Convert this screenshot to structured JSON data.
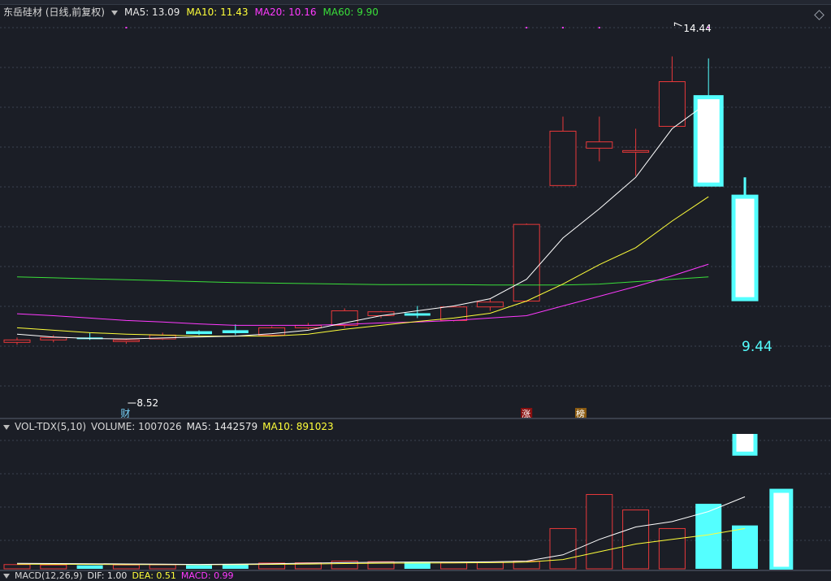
{
  "header": {
    "stock_title": "东岳硅材 (日线,前复权)",
    "ma5_label": "MA5: 13.09",
    "ma10_label": "MA10: 11.43",
    "ma20_label": "MA20: 10.16",
    "ma60_label": "MA60: 9.90"
  },
  "volume_header": {
    "label": "VOL-TDX(5,10)",
    "volume": "VOLUME: 1007026",
    "ma5": "MA5: 1442579",
    "ma10": "MA10: 891023"
  },
  "macd_header": {
    "label": "MACD(12,26,9)",
    "dif": "DIF: 1.00",
    "dea": "DEA: 0.51",
    "macd": "MACD: 0.99"
  },
  "colors": {
    "up": "#e8383a",
    "down": "#54ffff",
    "ma5": "#ffffff",
    "ma10": "#ffff3a",
    "ma20": "#ff3aff",
    "ma60": "#3adf3a",
    "grid": "#3b4150",
    "text": "#d8d8d8"
  },
  "chart_data": {
    "type": "candlestick",
    "price_ylim": [
      7.3,
      15.1
    ],
    "high_label": "14.44",
    "low_label": "8.52",
    "last_close_label": "9.44",
    "markers": {
      "cai": "财",
      "zhang": "涨",
      "bang": "榜"
    },
    "candles": [
      {
        "o": 8.55,
        "h": 8.65,
        "l": 8.5,
        "c": 8.6
      },
      {
        "o": 8.6,
        "h": 8.7,
        "l": 8.55,
        "c": 8.65
      },
      {
        "o": 8.65,
        "h": 8.75,
        "l": 8.6,
        "c": 8.63
      },
      {
        "o": 8.58,
        "h": 8.62,
        "l": 8.52,
        "c": 8.6
      },
      {
        "o": 8.62,
        "h": 8.75,
        "l": 8.6,
        "c": 8.7
      },
      {
        "o": 8.78,
        "h": 8.8,
        "l": 8.7,
        "c": 8.72
      },
      {
        "o": 8.8,
        "h": 8.92,
        "l": 8.7,
        "c": 8.74
      },
      {
        "o": 8.7,
        "h": 8.88,
        "l": 8.68,
        "c": 8.85
      },
      {
        "o": 8.85,
        "h": 8.95,
        "l": 8.82,
        "c": 8.9
      },
      {
        "o": 8.9,
        "h": 9.25,
        "l": 8.85,
        "c": 9.2
      },
      {
        "o": 9.1,
        "h": 9.2,
        "l": 9.05,
        "c": 9.18
      },
      {
        "o": 9.15,
        "h": 9.3,
        "l": 9.05,
        "c": 9.1
      },
      {
        "o": 9.0,
        "h": 9.3,
        "l": 8.98,
        "c": 9.28
      },
      {
        "o": 9.28,
        "h": 9.45,
        "l": 9.2,
        "c": 9.38
      },
      {
        "o": 9.4,
        "h": 11.0,
        "l": 9.38,
        "c": 10.98
      },
      {
        "o": 11.78,
        "h": 13.2,
        "l": 11.78,
        "c": 12.9
      },
      {
        "o": 12.55,
        "h": 13.2,
        "l": 12.28,
        "c": 12.68
      },
      {
        "o": 12.5,
        "h": 12.95,
        "l": 11.98,
        "c": 12.5
      },
      {
        "o": 13.0,
        "h": 14.44,
        "l": 13.0,
        "c": 13.92
      },
      {
        "o": 13.6,
        "h": 14.4,
        "l": 11.8,
        "c": 11.8
      },
      {
        "o": 11.55,
        "h": 11.95,
        "l": 9.44,
        "c": 9.44
      }
    ],
    "ma5": [
      8.72,
      8.66,
      8.63,
      8.62,
      8.64,
      8.66,
      8.68,
      8.73,
      8.8,
      8.95,
      9.1,
      9.2,
      9.3,
      9.45,
      9.85,
      10.7,
      11.3,
      11.95,
      12.95,
      13.5
    ],
    "ma10": [
      8.85,
      8.8,
      8.75,
      8.72,
      8.7,
      8.68,
      8.68,
      8.68,
      8.72,
      8.82,
      8.9,
      8.98,
      9.05,
      9.15,
      9.4,
      9.75,
      10.15,
      10.5,
      11.05,
      11.55
    ],
    "ma20": [
      9.14,
      9.1,
      9.05,
      9.0,
      8.97,
      8.93,
      8.9,
      8.9,
      8.9,
      8.92,
      8.95,
      8.97,
      9.0,
      9.05,
      9.1,
      9.3,
      9.5,
      9.7,
      9.92,
      10.16
    ],
    "ma60": [
      9.9,
      9.88,
      9.86,
      9.84,
      9.82,
      9.8,
      9.78,
      9.77,
      9.76,
      9.75,
      9.74,
      9.74,
      9.74,
      9.73,
      9.73,
      9.73,
      9.75,
      9.8,
      9.85,
      9.9
    ],
    "volume": [
      55000,
      50000,
      45000,
      50000,
      52000,
      48000,
      62000,
      75000,
      78000,
      100000,
      92000,
      90000,
      80000,
      85000,
      100000,
      520000,
      960000,
      760000,
      520000,
      840000,
      1680000,
      1007026
    ],
    "vol_ylim": [
      0,
      1700000
    ],
    "vol_ma5": [
      70000,
      68000,
      66000,
      63000,
      60000,
      57000,
      60000,
      66000,
      73000,
      80000,
      85000,
      88000,
      88000,
      90000,
      100000,
      180000,
      380000,
      540000,
      610000,
      740000,
      930000
    ],
    "vol_ma10": [
      60000,
      59000,
      58000,
      56000,
      55000,
      54000,
      55000,
      58000,
      62000,
      68000,
      72000,
      75000,
      77000,
      80000,
      86000,
      120000,
      220000,
      320000,
      380000,
      440000,
      520000
    ]
  }
}
